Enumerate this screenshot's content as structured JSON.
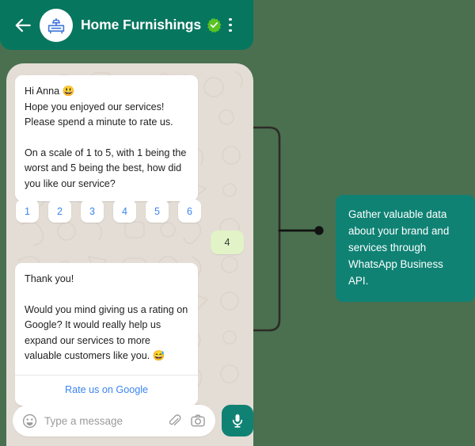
{
  "colors": {
    "page_background": "#4a7050",
    "header_green": "#07765f",
    "chat_background": "#e4ddd5",
    "accent_teal": "#0f8274",
    "link_blue": "#3b85f0",
    "outgoing_bubble_green": "#e2f3c7",
    "verified_green": "#58c322",
    "connector_gray": "#6b6862",
    "connector_black": "#121212"
  },
  "header": {
    "back_icon": "back-arrow-icon",
    "avatar_icon": "nightstand-lamp-icon",
    "title": "Home Furnishings",
    "verified_icon": "verified-badge-icon",
    "menu_icon": "overflow-menu-icon"
  },
  "chat": {
    "greeting_bubble": {
      "line1": "Hi Anna 😃",
      "line2": "Hope you enjoyed our services! Please spend a minute to rate us.",
      "line3": "On a scale of 1 to 5, with 1 being the worst and 5 being the best, how did you like our service?"
    },
    "rating_buttons": [
      "1",
      "2",
      "3",
      "4",
      "5",
      "6"
    ],
    "rating_reply": "4",
    "thanks_bubble": {
      "line1": "Thank you!",
      "line2": "Would you mind giving us a rating on Google? It would really help us expand our services to more valuable customers like you. 😅",
      "link_label": "Rate us on Google"
    }
  },
  "composer": {
    "emoji_icon": "emoji-smiley-icon",
    "placeholder": "Type a message",
    "attach_icon": "paperclip-icon",
    "camera_icon": "camera-icon",
    "mic_icon": "microphone-icon"
  },
  "callout": {
    "text": "Gather valuable data about your brand and services through WhatsApp Business API."
  }
}
